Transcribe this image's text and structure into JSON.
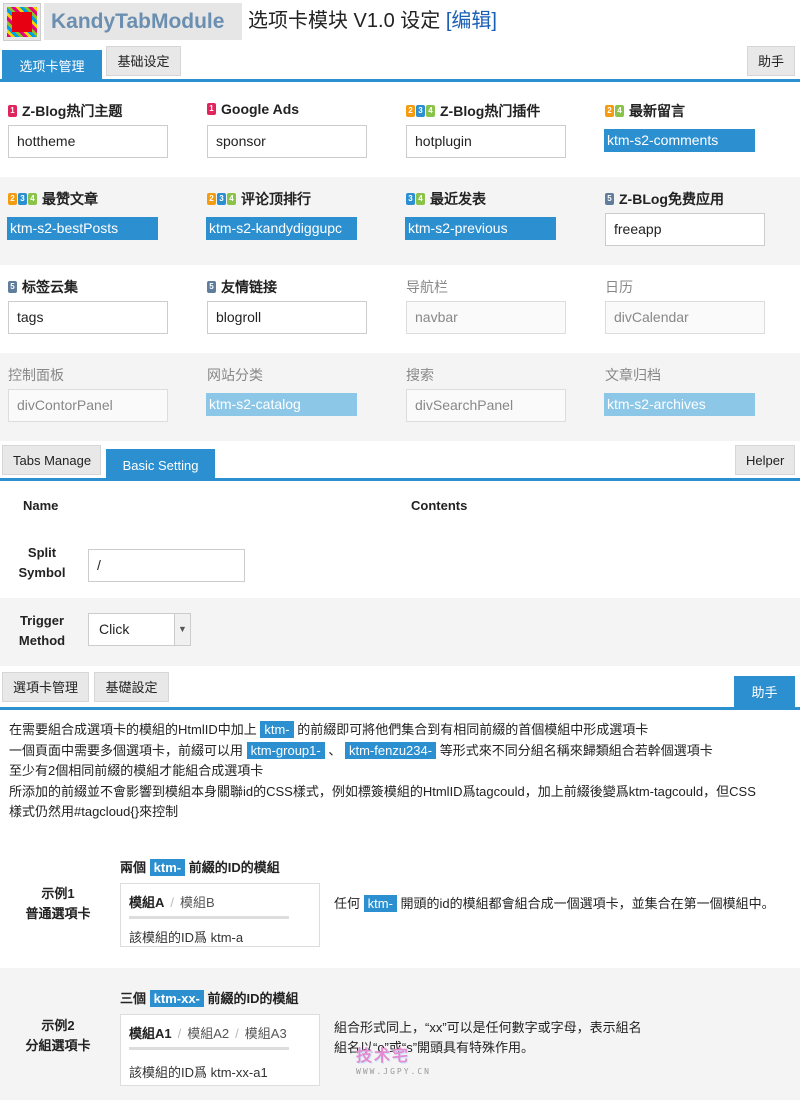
{
  "header": {
    "app_name": "KandyTabModule",
    "title": "选项卡模块 V1.0 设定",
    "edit_link": "[编辑]"
  },
  "tabs_cn": {
    "manage": "选项卡管理",
    "basic": "基础设定",
    "helper": "助手"
  },
  "modules": [
    {
      "label": "Z-Blog热门主题",
      "badges": [
        "1"
      ],
      "value": "hottheme",
      "style": "normal"
    },
    {
      "label": "Google Ads",
      "badges": [
        "1"
      ],
      "value": "sponsor",
      "style": "normal"
    },
    {
      "label": "Z-Blog热门插件",
      "badges": [
        "2",
        "3",
        "4"
      ],
      "value": "hotplugin",
      "style": "normal"
    },
    {
      "label": "最新留言",
      "badges": [
        "2",
        "4"
      ],
      "value": "ktm-s2-comments",
      "style": "highlight"
    },
    {
      "label": "最赞文章",
      "badges": [
        "2",
        "3",
        "4"
      ],
      "value": "ktm-s2-bestPosts",
      "style": "highlight"
    },
    {
      "label": "评论顶排行",
      "badges": [
        "2",
        "3",
        "4"
      ],
      "value": "ktm-s2-kandydiggupc",
      "style": "highlight"
    },
    {
      "label": "最近发表",
      "badges": [
        "3",
        "4"
      ],
      "value": "ktm-s2-previous",
      "style": "highlight"
    },
    {
      "label": "Z-BLog免费应用",
      "badges": [
        "5"
      ],
      "value": "freeapp",
      "style": "normal"
    },
    {
      "label": "标签云集",
      "badges": [
        "5"
      ],
      "value": "tags",
      "style": "normal"
    },
    {
      "label": "友情链接",
      "badges": [
        "5"
      ],
      "value": "blogroll",
      "style": "normal"
    },
    {
      "label": "导航栏",
      "badges": [],
      "value": "navbar",
      "style": "disabled"
    },
    {
      "label": "日历",
      "badges": [],
      "value": "divCalendar",
      "style": "disabled"
    },
    {
      "label": "控制面板",
      "badges": [],
      "value": "divContorPanel",
      "style": "disabled"
    },
    {
      "label": "网站分类",
      "badges": [],
      "value": "ktm-s2-catalog",
      "style": "highlight-light"
    },
    {
      "label": "搜索",
      "badges": [],
      "value": "divSearchPanel",
      "style": "disabled"
    },
    {
      "label": "文章归档",
      "badges": [],
      "value": "ktm-s2-archives",
      "style": "highlight-light"
    }
  ],
  "tabs_en": {
    "manage": "Tabs Manage",
    "basic": "Basic Setting",
    "helper": "Helper"
  },
  "basic_setting": {
    "col_name": "Name",
    "col_contents": "Contents",
    "split_label_1": "Split",
    "split_label_2": "Symbol",
    "split_value": "/",
    "trigger_label_1": "Trigger",
    "trigger_label_2": "Method",
    "trigger_value": "Click"
  },
  "tabs_tw": {
    "manage": "選項卡管理",
    "basic": "基礎設定",
    "helper": "助手"
  },
  "help": {
    "l1a": "在需要組合成選項卡的模組的HtmlID中加上",
    "l1tag": "ktm-",
    "l1b": "的前綴即可將他們集合到有相同前綴的首個模組中形成選項卡",
    "l2a": "一個頁面中需要多個選項卡，前綴可以用",
    "l2tag1": "ktm-group1-",
    "l2sep": "、",
    "l2tag2": "ktm-fenzu234-",
    "l2b": "等形式來不同分組名稱來歸類組合若幹個選項卡",
    "l3": "至少有2個相同前綴的模組才能組合成選項卡",
    "l4": "所添加的前綴並不會影響到模組本身關聯id的CSS樣式，例如標簽模組的HtmlID爲tagcould，加上前綴後變爲ktm-tagcould，但CSS",
    "l5": "樣式仍然用#tagcloud{}來控制"
  },
  "example1": {
    "label_1": "示例1",
    "label_2": "普通選項卡",
    "title_a": "兩個",
    "title_tag": "ktm-",
    "title_b": "前綴的ID的模組",
    "tab_first": "模組A",
    "tab_other": "模組B",
    "body": "該模組的ID爲 ktm-a",
    "desc_a": "任何",
    "desc_tag": "ktm-",
    "desc_b": "開頭的id的模組都會組合成一個選項卡，並集合在第一個模組中。"
  },
  "example2": {
    "label_1": "示例2",
    "label_2": "分組選項卡",
    "title_a": "三個",
    "title_tag": "ktm-xx-",
    "title_b": "前綴的ID的模組",
    "tab_first": "模組A1",
    "tab_other1": "模組A2",
    "tab_other2": "模組A3",
    "body": "該模組的ID爲 ktm-xx-a1",
    "desc_1": "組合形式同上，“xx”可以是任何數字或字母，表示組名",
    "desc_2": "組名以“o”或“s”開頭具有特殊作用。"
  },
  "watermark": {
    "main": "技术宅",
    "sub": "WWW.JGPY.CN"
  },
  "colors": {
    "accent": "#2b8fd0",
    "accent_light": "#8cc7e8",
    "brand_red": "#e60012"
  }
}
